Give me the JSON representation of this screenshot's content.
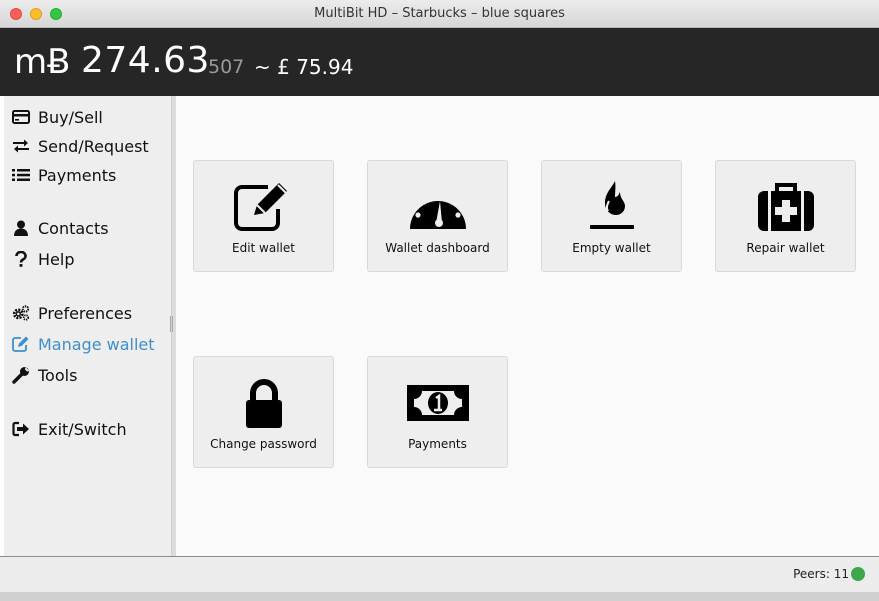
{
  "window": {
    "title": "MultiBit HD – Starbucks – blue squares"
  },
  "balance": {
    "symbol": "mɃ",
    "amount": "274.63",
    "small_digits": "507",
    "fiat": "~ £ 75.94"
  },
  "sidebar": {
    "items": [
      {
        "label": "Buy/Sell",
        "icon": "credit-card-icon"
      },
      {
        "label": "Send/Request",
        "icon": "exchange-icon"
      },
      {
        "label": "Payments",
        "icon": "list-icon"
      },
      {
        "label": "Contacts",
        "icon": "user-icon"
      },
      {
        "label": "Help",
        "icon": "question-icon"
      },
      {
        "label": "Preferences",
        "icon": "gears-icon"
      },
      {
        "label": "Manage wallet",
        "icon": "edit-icon",
        "active": true
      },
      {
        "label": "Tools",
        "icon": "wrench-icon"
      },
      {
        "label": "Exit/Switch",
        "icon": "sign-out-icon"
      }
    ]
  },
  "cards": [
    {
      "label": "Edit wallet",
      "icon": "edit-wallet-icon"
    },
    {
      "label": "Wallet dashboard",
      "icon": "dashboard-icon"
    },
    {
      "label": "Empty wallet",
      "icon": "fire-icon"
    },
    {
      "label": "Repair wallet",
      "icon": "medkit-icon"
    },
    {
      "label": "Change password",
      "icon": "lock-icon"
    },
    {
      "label": "Payments",
      "icon": "banknote-icon"
    }
  ],
  "status": {
    "peers": "Peers: 11"
  },
  "colors": {
    "accent": "#3d8fd1",
    "header_bg": "#262626",
    "peers_ok": "#3fa74b"
  }
}
